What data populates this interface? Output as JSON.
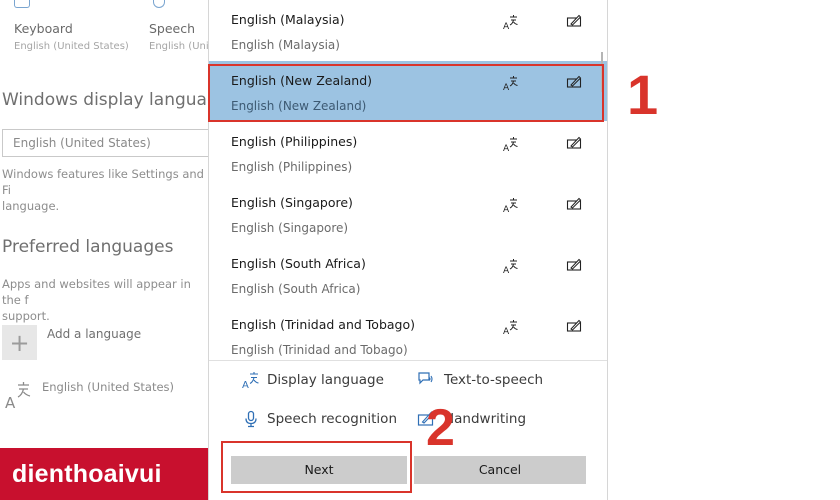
{
  "background": {
    "keyboard": {
      "title": "Keyboard",
      "subtitle": "English (United States)"
    },
    "speech": {
      "title": "Speech",
      "subtitle": "English (United States)"
    },
    "display_section": {
      "title": "Windows display language",
      "dropdown_value": "English (United States)",
      "description_line1": "Windows features like Settings and Fi",
      "description_line2": "language."
    },
    "preferred_section": {
      "title": "Preferred languages",
      "description_line1": "Apps and websites will appear in the f",
      "description_line2": "support.",
      "add_label": "Add a language",
      "add_glyph": "+",
      "current_language": "English (United States)"
    }
  },
  "brand": {
    "text": "dienthoaivui"
  },
  "dialog": {
    "languages": [
      {
        "name": "English (Malaysia)",
        "native": "English (Malaysia)"
      },
      {
        "name": "English (New Zealand)",
        "native": "English (New Zealand)"
      },
      {
        "name": "English (Philippines)",
        "native": "English (Philippines)"
      },
      {
        "name": "English (Singapore)",
        "native": "English (Singapore)"
      },
      {
        "name": "English (South Africa)",
        "native": "English (South Africa)"
      },
      {
        "name": "English (Trinidad and Tobago)",
        "native": "English (Trinidad and Tobago)"
      }
    ],
    "selected_index": 1,
    "features": {
      "display_language": "Display language",
      "text_to_speech": "Text-to-speech",
      "speech_recognition": "Speech recognition",
      "handwriting": "Handwriting"
    },
    "buttons": {
      "next": "Next",
      "cancel": "Cancel"
    }
  },
  "annotations": {
    "step1": "1",
    "step2": "2",
    "color": "#d9342b"
  },
  "colors": {
    "selected_row": "#9cc3e2",
    "brand": "#c8102e",
    "button": "#cccccc"
  }
}
